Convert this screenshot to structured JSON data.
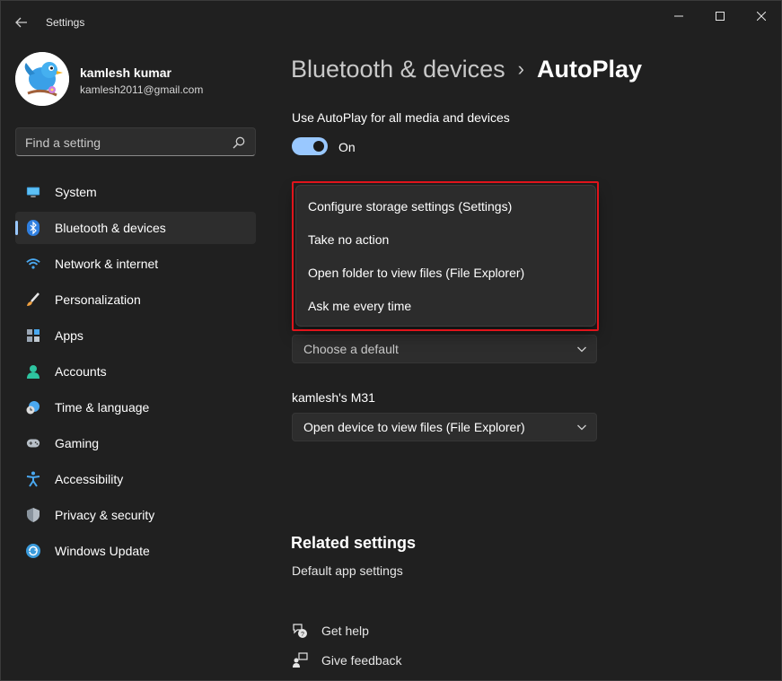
{
  "window": {
    "title": "Settings"
  },
  "profile": {
    "name": "kamlesh kumar",
    "email": "kamlesh2011@gmail.com"
  },
  "search": {
    "placeholder": "Find a setting"
  },
  "nav": {
    "items": [
      {
        "label": "System",
        "icon": "monitor-icon"
      },
      {
        "label": "Bluetooth & devices",
        "icon": "bluetooth-icon",
        "active": true
      },
      {
        "label": "Network & internet",
        "icon": "wifi-icon"
      },
      {
        "label": "Personalization",
        "icon": "brush-icon"
      },
      {
        "label": "Apps",
        "icon": "apps-icon"
      },
      {
        "label": "Accounts",
        "icon": "person-icon"
      },
      {
        "label": "Time & language",
        "icon": "globe-clock-icon"
      },
      {
        "label": "Gaming",
        "icon": "gamepad-icon"
      },
      {
        "label": "Accessibility",
        "icon": "accessibility-icon"
      },
      {
        "label": "Privacy & security",
        "icon": "shield-icon"
      },
      {
        "label": "Windows Update",
        "icon": "update-icon"
      }
    ]
  },
  "breadcrumb": {
    "parent": "Bluetooth & devices",
    "separator": "›",
    "current": "AutoPlay"
  },
  "autoplay": {
    "toggle_label": "Use AutoPlay for all media and devices",
    "toggle_state": "On",
    "memory_card_value": "Choose a default",
    "device_name": "kamlesh's M31",
    "device_value": "Open device to view files (File Explorer)"
  },
  "flyout": {
    "options": [
      "Configure storage settings (Settings)",
      "Take no action",
      "Open folder to view files (File Explorer)",
      "Ask me every time"
    ]
  },
  "related": {
    "title": "Related settings",
    "link": "Default app settings"
  },
  "help": {
    "get_help": "Get help",
    "give_feedback": "Give feedback"
  },
  "colors": {
    "accent": "#99c8ff",
    "highlight_border": "#e0141b",
    "background": "#202020"
  }
}
